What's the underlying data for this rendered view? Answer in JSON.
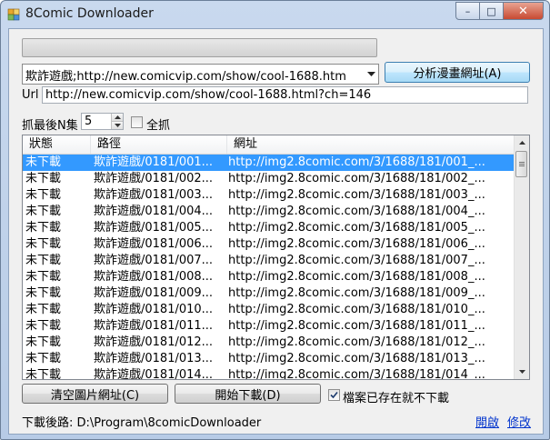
{
  "window": {
    "title": "8Comic Downloader",
    "controls": {
      "minimize": "–",
      "maximize": "□",
      "close": "✕"
    }
  },
  "progress": {
    "value": 0
  },
  "source_combo": {
    "value": "欺詐遊戲;http://new.comicvip.com/show/cool-1688.htm",
    "arrow_icon": "▾"
  },
  "analyze_button": {
    "label": "分析漫畫網址(A)"
  },
  "url": {
    "label": "Url",
    "value": "http://new.comicvip.com/show/cool-1688.html?ch=146"
  },
  "last_n": {
    "label": "抓最後N集",
    "value": "5"
  },
  "grab_all": {
    "label": "全抓",
    "checked": false
  },
  "list": {
    "columns": [
      "狀態",
      "路徑",
      "網址"
    ],
    "rows": [
      [
        "未下載",
        "欺詐遊戲/0181/001...",
        "http://img2.8comic.com/3/1688/181/001_..."
      ],
      [
        "未下載",
        "欺詐遊戲/0181/002...",
        "http://img2.8comic.com/3/1688/181/002_..."
      ],
      [
        "未下載",
        "欺詐遊戲/0181/003...",
        "http://img2.8comic.com/3/1688/181/003_..."
      ],
      [
        "未下載",
        "欺詐遊戲/0181/004...",
        "http://img2.8comic.com/3/1688/181/004_..."
      ],
      [
        "未下載",
        "欺詐遊戲/0181/005...",
        "http://img2.8comic.com/3/1688/181/005_..."
      ],
      [
        "未下載",
        "欺詐遊戲/0181/006...",
        "http://img2.8comic.com/3/1688/181/006_..."
      ],
      [
        "未下載",
        "欺詐遊戲/0181/007...",
        "http://img2.8comic.com/3/1688/181/007_..."
      ],
      [
        "未下載",
        "欺詐遊戲/0181/008...",
        "http://img2.8comic.com/3/1688/181/008_..."
      ],
      [
        "未下載",
        "欺詐遊戲/0181/009...",
        "http://img2.8comic.com/3/1688/181/009_..."
      ],
      [
        "未下載",
        "欺詐遊戲/0181/010...",
        "http://img2.8comic.com/3/1688/181/010_..."
      ],
      [
        "未下載",
        "欺詐遊戲/0181/011...",
        "http://img2.8comic.com/3/1688/181/011_..."
      ],
      [
        "未下載",
        "欺詐遊戲/0181/012...",
        "http://img2.8comic.com/3/1688/181/012_..."
      ],
      [
        "未下載",
        "欺詐遊戲/0181/013...",
        "http://img2.8comic.com/3/1688/181/013_..."
      ],
      [
        "未下載",
        "欺詐遊戲/0181/014...",
        "http://img2.8comic.com/3/1688/181/014_..."
      ]
    ],
    "selected_row": 0
  },
  "clear_button": {
    "label": "清空圖片網址(C)"
  },
  "start_button": {
    "label": "開始下載(D)"
  },
  "skip_existing": {
    "label": "檔案已存在就不下載",
    "checked": true
  },
  "download_path": {
    "text": "下載後路: D:\\Program\\8comicDownloader"
  },
  "links": {
    "open": "開啟",
    "edit": "修改"
  },
  "colors": {
    "selection": "#3399ff",
    "link": "#0033cc",
    "titlebar": "#c9d9ee",
    "close_button": "#c84a32"
  }
}
